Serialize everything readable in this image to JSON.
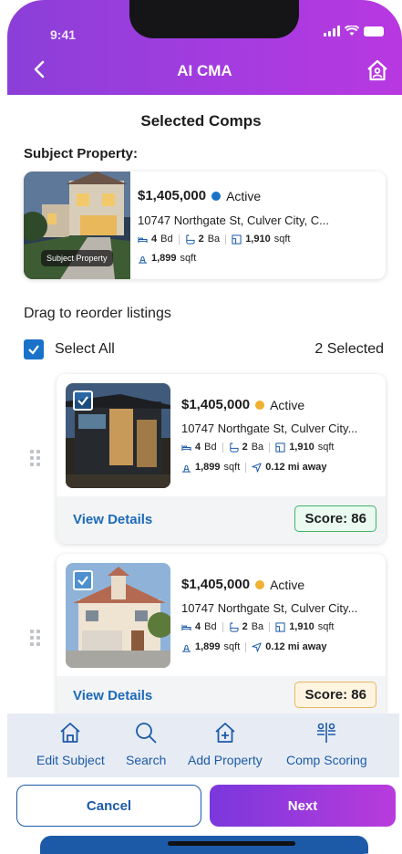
{
  "status_bar": {
    "time": "9:41"
  },
  "header": {
    "title": "AI CMA"
  },
  "section_title": "Selected Comps",
  "subject": {
    "label": "Subject Property:",
    "badge": "Subject Property",
    "price": "$1,405,000",
    "status": "Active",
    "status_color": "#1a72c8",
    "address": "10747 Northgate St, Culver City, C...",
    "beds": "4",
    "beds_unit": "Bd",
    "baths": "2",
    "baths_unit": "Ba",
    "sqft": "1,910",
    "sqft_unit": "sqft",
    "lot": "1,899",
    "lot_unit": "sqft"
  },
  "drag_label": "Drag to reorder listings",
  "select_all": {
    "label": "Select All",
    "count": "2 Selected"
  },
  "listings": [
    {
      "price": "$1,405,000",
      "status": "Active",
      "status_color": "#f0b030",
      "address": "10747 Northgate St, Culver City...",
      "beds": "4",
      "beds_unit": "Bd",
      "baths": "2",
      "baths_unit": "Ba",
      "sqft": "1,910",
      "sqft_unit": "sqft",
      "lot": "1,899",
      "lot_unit": "sqft",
      "distance": "0.12 mi away",
      "view_details": "View Details",
      "score": "Score: 86"
    },
    {
      "price": "$1,405,000",
      "status": "Active",
      "status_color": "#f0b030",
      "address": "10747 Northgate St, Culver City...",
      "beds": "4",
      "beds_unit": "Bd",
      "baths": "2",
      "baths_unit": "Ba",
      "sqft": "1,910",
      "sqft_unit": "sqft",
      "lot": "1,899",
      "lot_unit": "sqft",
      "distance": "0.12 mi away",
      "view_details": "View Details",
      "score": "Score: 86"
    }
  ],
  "toolbar": {
    "edit_subject": "Edit Subject",
    "search": "Search",
    "add_property": "Add Property",
    "comp_scoring": "Comp Scoring"
  },
  "actions": {
    "cancel": "Cancel",
    "next": "Next"
  },
  "colors": {
    "accent": "#1c5aa8",
    "header_start": "#8b3fd8",
    "header_end": "#b838e0"
  }
}
